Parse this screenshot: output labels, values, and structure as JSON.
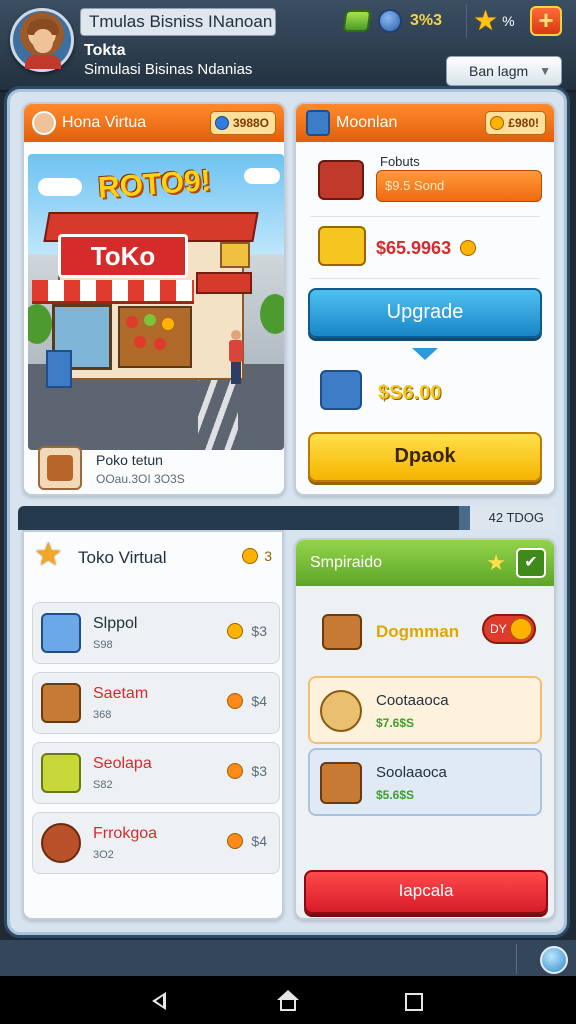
{
  "header": {
    "title": "Tmulas Bisniss INanoan",
    "player_name": "Tokta",
    "player_subtitle": "Simulasi Bisinas Ndanias",
    "resource_value": "3%3",
    "star_label": "%",
    "dropdown_label": "Ban lagm"
  },
  "store_panel": {
    "title": "Hona Virtua",
    "badge": "3988O",
    "promo_text": "ROTO9!",
    "sign_text": "ToKo",
    "store_name": "Poko tetun",
    "store_meta": "OOau.3OI 3O3S"
  },
  "upgrade_panel": {
    "title": "Moonlan",
    "badge": "£980!",
    "product_label": "Fobuts",
    "product_pill": "$9.5 Sond",
    "price_red": "$65.9963",
    "upgrade_button": "Upgrade",
    "price_gold": "$S6.00",
    "buy_button": "Dpaok"
  },
  "divider": {
    "value": "42 TDOG"
  },
  "inventory": {
    "title": "Toko Virtual",
    "coin_count": "3",
    "items": [
      {
        "name": "Slppol",
        "sub": "S98",
        "cost": "$3",
        "color": "#22313f"
      },
      {
        "name": "Saetam",
        "sub": "368",
        "cost": "$4",
        "color": "#d62b2b"
      },
      {
        "name": "Seolapa",
        "sub": "S82",
        "cost": "$3",
        "color": "#d62b2b"
      },
      {
        "name": "Frrokgoa",
        "sub": "3O2",
        "cost": "$4",
        "color": "#d62b2b"
      }
    ]
  },
  "promo_panel": {
    "title": "Smpiraido",
    "promo_name": "Dogmman",
    "toggle_label": "DY",
    "offers": [
      {
        "name": "Cootaaoca",
        "price": "$7.6$S"
      },
      {
        "name": "Soolaaoca",
        "price": "$5.6$S"
      }
    ],
    "button": "Iapcala"
  },
  "colors": {
    "orange_header": "#ef6a10",
    "green_header": "#5ea628",
    "upgrade_blue": "#1a86c8",
    "buy_yellow": "#f5b400",
    "action_red": "#d61c2a"
  },
  "icons": [
    "avatar",
    "gem-icon",
    "bag-icon",
    "star-icon",
    "plus-icon",
    "chevron-down-icon",
    "globe-icon",
    "back-icon",
    "home-icon",
    "recents-icon"
  ]
}
